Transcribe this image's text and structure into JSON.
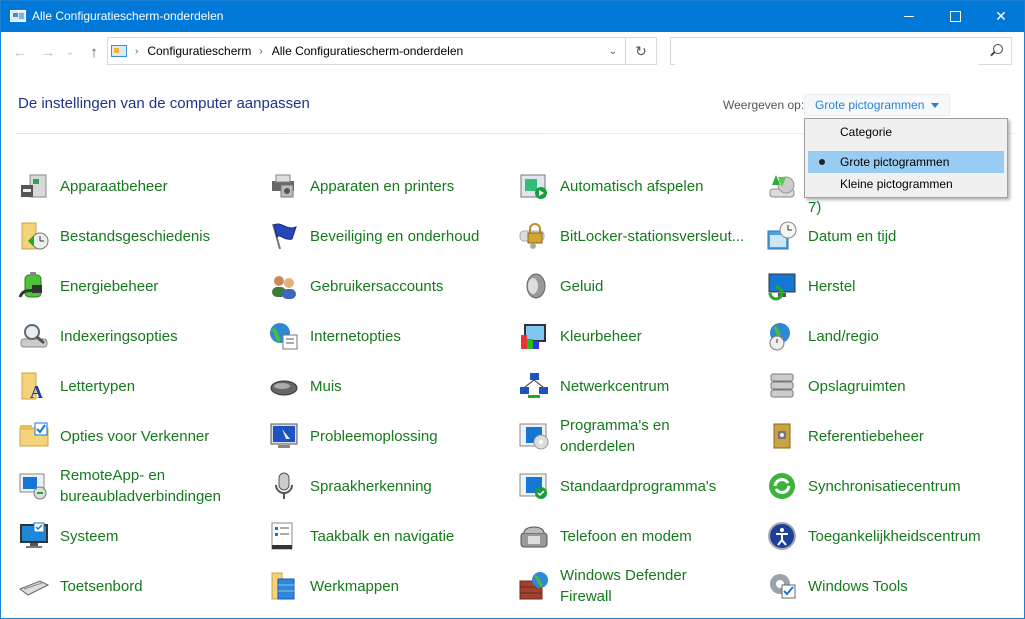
{
  "window": {
    "title": "Alle Configuratiescherm-onderdelen",
    "controls": {
      "minimize": "minimize",
      "maximize": "maximize",
      "close": "✕"
    }
  },
  "navigation": {
    "back": "←",
    "forward": "→",
    "recent": "⌄",
    "up": "↑"
  },
  "address": {
    "crumbs": [
      "Configuratiescherm",
      "Alle Configuratiescherm-onderdelen"
    ],
    "separator": "›",
    "dropdown": "⌄",
    "refresh": "↻"
  },
  "search": {
    "value": "",
    "placeholder": ""
  },
  "header": {
    "title": "De instellingen van de computer aanpassen",
    "view_label": "Weergeven op:",
    "view_selected": "Grote pictogrammen"
  },
  "view_menu": {
    "options": [
      "Categorie",
      "Grote pictogrammen",
      "Kleine pictogrammen"
    ],
    "selected": "Grote pictogrammen"
  },
  "colors": {
    "titlebar": "#0078d7",
    "item_text": "#147a1b",
    "heading_text": "#1e3287",
    "link_blue": "#2d7fd1",
    "menu_selected": "#99ccf3"
  },
  "items": [
    {
      "label": "Apparaatbeheer",
      "icon": "device-manager-icon"
    },
    {
      "label": "Apparaten en printers",
      "icon": "devices-printers-icon"
    },
    {
      "label": "Automatisch afspelen",
      "icon": "autoplay-icon"
    },
    {
      "label": "Back-up maken en terugzetten (Windows 7)",
      "icon": "backup-restore-icon"
    },
    {
      "label": "Bestandsgeschiedenis",
      "icon": "file-history-icon"
    },
    {
      "label": "Beveiliging en onderhoud",
      "icon": "security-maintenance-flag-icon"
    },
    {
      "label": "BitLocker-stationsversleut...",
      "icon": "bitlocker-lock-icon"
    },
    {
      "label": "Datum en tijd",
      "icon": "date-time-icon"
    },
    {
      "label": "Energiebeheer",
      "icon": "power-battery-icon"
    },
    {
      "label": "Gebruikersaccounts",
      "icon": "user-accounts-icon"
    },
    {
      "label": "Geluid",
      "icon": "sound-speaker-icon"
    },
    {
      "label": "Herstel",
      "icon": "recovery-icon"
    },
    {
      "label": "Indexeringsopties",
      "icon": "indexing-icon"
    },
    {
      "label": "Internetopties",
      "icon": "internet-options-icon"
    },
    {
      "label": "Kleurbeheer",
      "icon": "color-management-icon"
    },
    {
      "label": "Land/regio",
      "icon": "region-globe-icon"
    },
    {
      "label": "Lettertypen",
      "icon": "fonts-icon"
    },
    {
      "label": "Muis",
      "icon": "mouse-icon"
    },
    {
      "label": "Netwerkcentrum",
      "icon": "network-center-icon"
    },
    {
      "label": "Opslagruimten",
      "icon": "storage-spaces-icon"
    },
    {
      "label": "Opties voor Verkenner",
      "icon": "explorer-options-icon"
    },
    {
      "label": "Probleemoplossing",
      "icon": "troubleshooting-icon"
    },
    {
      "label": "Programma's en onderdelen",
      "icon": "programs-features-icon"
    },
    {
      "label": "Referentiebeheer",
      "icon": "credential-manager-icon"
    },
    {
      "label": "RemoteApp- en bureaubladverbindingen",
      "icon": "remoteapp-icon"
    },
    {
      "label": "Spraakherkenning",
      "icon": "speech-microphone-icon"
    },
    {
      "label": "Standaardprogramma's",
      "icon": "default-programs-icon"
    },
    {
      "label": "Synchronisatiecentrum",
      "icon": "sync-center-icon"
    },
    {
      "label": "Systeem",
      "icon": "system-monitor-icon"
    },
    {
      "label": "Taakbalk en navigatie",
      "icon": "taskbar-icon"
    },
    {
      "label": "Telefoon en modem",
      "icon": "phone-modem-icon"
    },
    {
      "label": "Toegankelijkheidscentrum",
      "icon": "ease-of-access-icon"
    },
    {
      "label": "Toetsenbord",
      "icon": "keyboard-icon"
    },
    {
      "label": "Werkmappen",
      "icon": "work-folders-icon"
    },
    {
      "label": "Windows Defender Firewall",
      "icon": "firewall-icon"
    },
    {
      "label": "Windows Tools",
      "icon": "windows-tools-icon"
    }
  ]
}
